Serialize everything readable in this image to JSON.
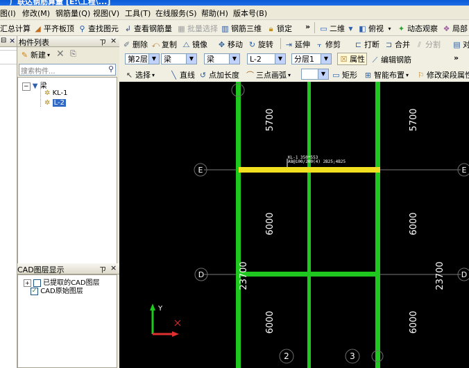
{
  "app_title": "广联达钢筋算量 [E:\\工程\\...]",
  "menu": [
    "图(I)",
    "修改(M)",
    "钢筋量(Q)",
    "视图(V)",
    "工具(T)",
    "在线服务(S)",
    "帮助(H)",
    "版本号(B)"
  ],
  "toolbar1": {
    "summary": "汇总计算",
    "flush": "平齐板顶",
    "find": "查找图元",
    "view_rebar": "查看钢筋量",
    "batch_select": "批量选择",
    "rebar_3d": "钢筋三维",
    "lock": "锁定",
    "more": "»",
    "view_mode": "二维",
    "top_view": "俯视",
    "dynamic_view": "动态观察",
    "local": "局部"
  },
  "toolbar2": {
    "delete": "删除",
    "copy": "复制",
    "mirror": "镜像",
    "move": "移动",
    "rotate": "旋转",
    "extend": "延伸",
    "trim": "修剪",
    "break": "打断",
    "merge": "合并",
    "split": "分割",
    "align": "对"
  },
  "toolbar3": {
    "floor": "第2层",
    "category": "梁",
    "type": "梁",
    "component": "L-2",
    "layer": "分层1",
    "properties": "属性",
    "edit_rebar": "编辑钢筋",
    "more": "»"
  },
  "toolbar4": {
    "select": "选择",
    "line": "直线",
    "point_length": "点加长度",
    "arc": "三点画弧",
    "rect": "矩形",
    "smart_layout": "智能布置",
    "modify_beam": "修改梁段属性"
  },
  "left_panel": {
    "close": "×",
    "component_list_title": "构件列表",
    "pin": "ㄗ",
    "new_button": "新建",
    "search_placeholder": "搜索构件...",
    "tree_root": "梁",
    "tree_items": [
      "KL-1",
      "L-2"
    ],
    "cad_title": "CAD图层显示",
    "cad_items": [
      "已提取的CAD图层",
      "CAD原始图层"
    ]
  },
  "canvas": {
    "dims_left": [
      "5700",
      "6000",
      "6000"
    ],
    "dims_right": [
      "5700",
      "6000",
      "6000"
    ],
    "dim_total_right": "23700",
    "dim_total_left": "23700",
    "axis_rows": [
      "E",
      "D"
    ],
    "axis_cols": [
      "2",
      "3"
    ],
    "beam_label_line1": "KL-1 350*553",
    "beam_label_line2": "A8@100/200(4) 2B25;4B25",
    "ucs_y": "Y"
  },
  "colors": {
    "beam_green": "#1ec81e",
    "beam_selected": "#f0e020",
    "axis_line": "#7a7a7a",
    "canvas_bg": "#000000"
  }
}
